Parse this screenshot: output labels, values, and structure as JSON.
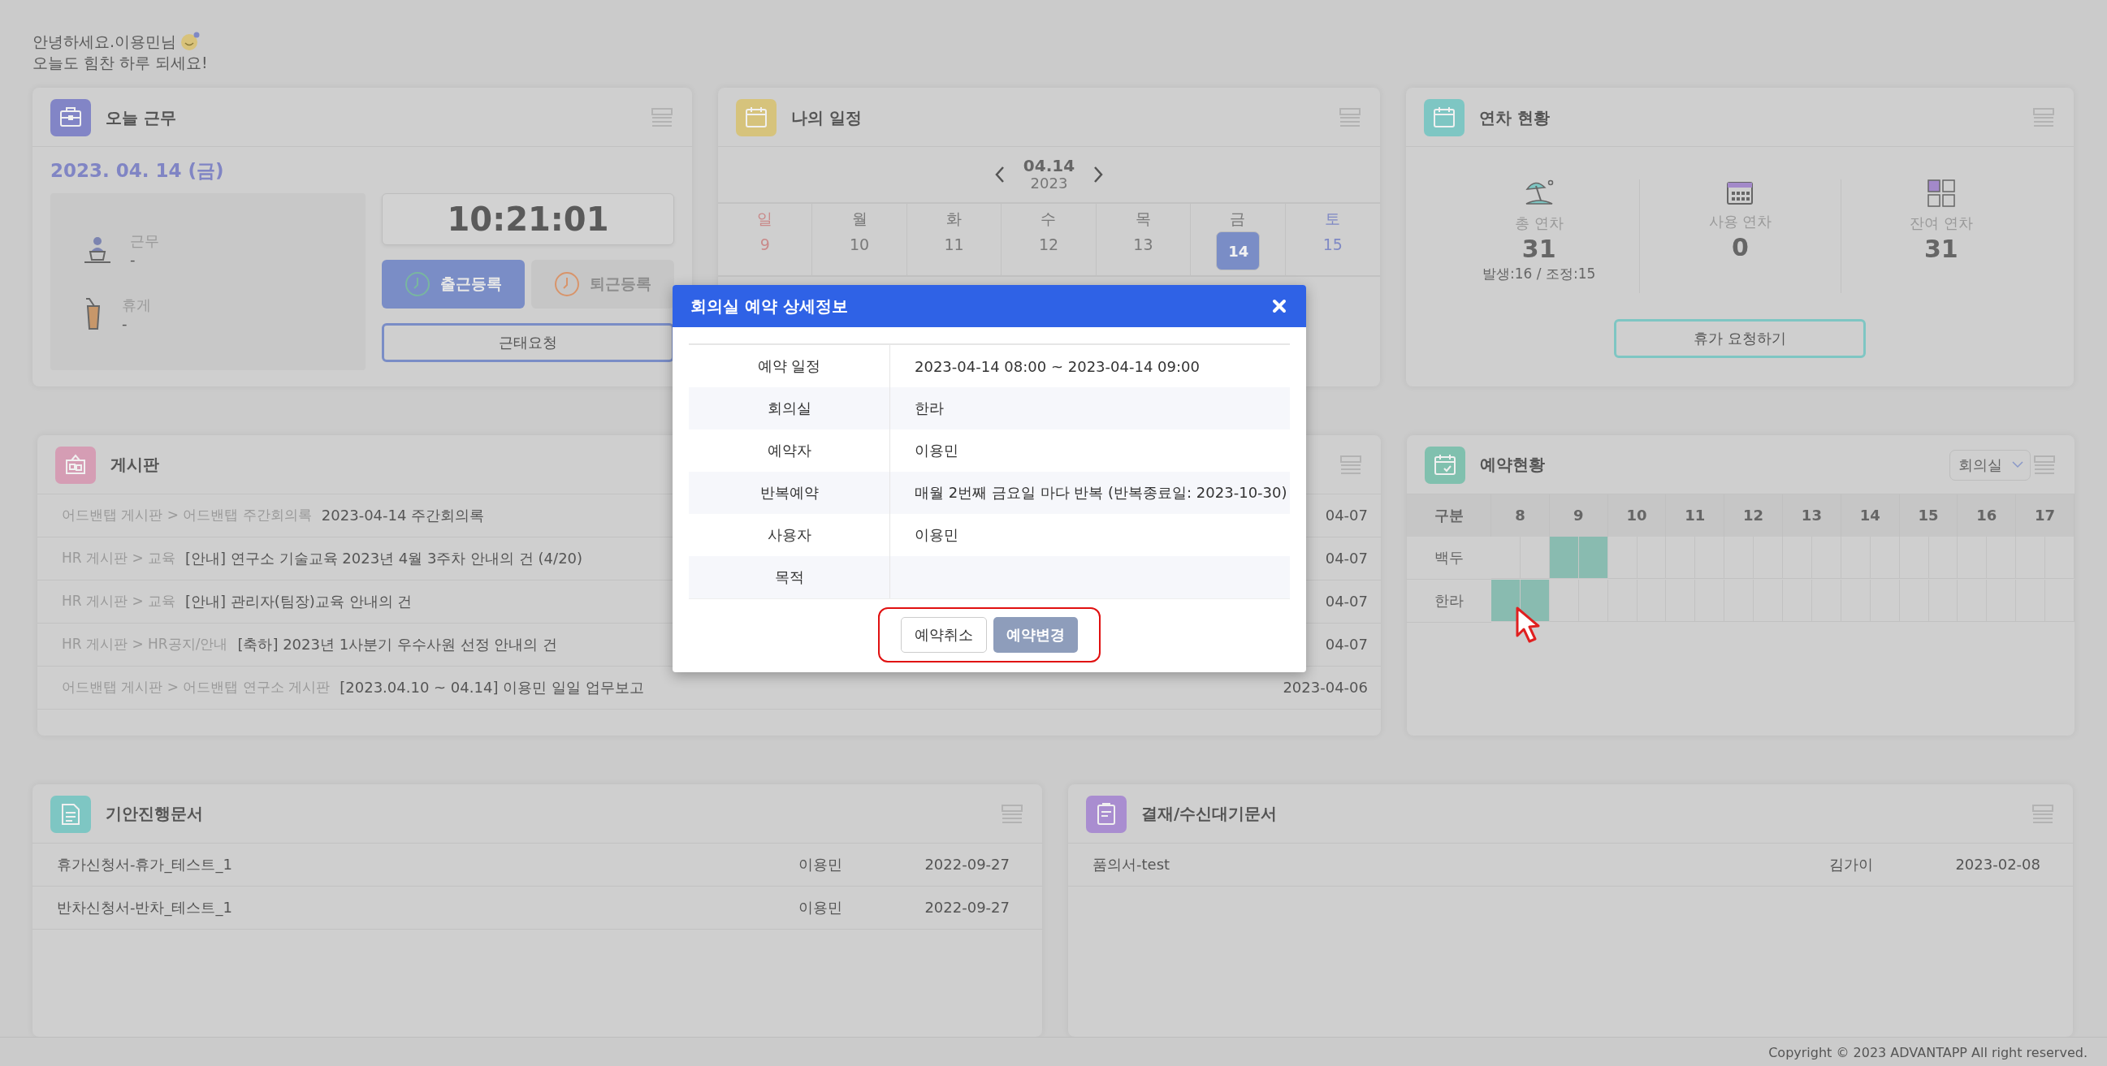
{
  "greeting": {
    "line1": "안녕하세요.이용민님",
    "line2": "오늘도 힘찬 하루 되세요!"
  },
  "today_work": {
    "title": "오늘 근무",
    "date": "2023. 04. 14 (금)",
    "clock": "10:21:01",
    "request_button": "근태요청",
    "status": [
      {
        "kind": "work",
        "label": "근무",
        "value": "-"
      },
      {
        "kind": "break",
        "label": "휴게",
        "value": "-"
      }
    ],
    "buttons": [
      {
        "kind": "clock_in",
        "label": "출근등록",
        "disabled": false
      },
      {
        "kind": "clock_out",
        "label": "퇴근등록",
        "disabled": true
      }
    ]
  },
  "schedule": {
    "title": "나의 일정",
    "date": "04.14",
    "year": "2023",
    "days": [
      {
        "kind": "sunday",
        "weekday": "일",
        "day": "9",
        "selected": false
      },
      {
        "kind": "weekday",
        "weekday": "월",
        "day": "10",
        "selected": false
      },
      {
        "kind": "weekday",
        "weekday": "화",
        "day": "11",
        "selected": false
      },
      {
        "kind": "weekday",
        "weekday": "수",
        "day": "12",
        "selected": false
      },
      {
        "kind": "weekday",
        "weekday": "목",
        "day": "13",
        "selected": false
      },
      {
        "kind": "weekday",
        "weekday": "금",
        "day": "14",
        "selected": true
      },
      {
        "kind": "saturday",
        "weekday": "토",
        "day": "15",
        "selected": false
      }
    ]
  },
  "leave": {
    "title": "연차 현황",
    "button": "휴가 요청하기",
    "stats": [
      {
        "kind": "total",
        "label": "총 연차",
        "value": "31",
        "note": "발생:16 / 조정:15"
      },
      {
        "kind": "used",
        "label": "사용 연차",
        "value": "0"
      },
      {
        "kind": "remaining",
        "label": "잔여 연차",
        "value": "31"
      }
    ]
  },
  "board": {
    "title": "게시판",
    "posts": [
      {
        "path": "어드밴탭 게시판 > 어드밴탭 주간회의록",
        "title": "2023-04-14 주간회의록",
        "date": "04-07"
      },
      {
        "path": "HR 게시판 > 교육",
        "title": "[안내] 연구소 기술교육 2023년 4월 3주차 안내의 건 (4/20)",
        "date": "04-07"
      },
      {
        "path": "HR 게시판 > 교육",
        "title": "[안내] 관리자(팀장)교육 안내의 건",
        "date": "04-07"
      },
      {
        "path": "HR 게시판 > HR공지/안내",
        "title": "[축하] 2023년 1사분기 우수사원 선정 안내의 건",
        "date": "04-07"
      },
      {
        "path": "어드밴탭 게시판 > 어드밴탭 연구소 게시판",
        "title": "[2023.04.10 ~ 04.14] 이용민 일일 업무보고",
        "date": "2023-04-06"
      }
    ]
  },
  "reservations": {
    "title": "예약현황",
    "select": "회의실",
    "columns": [
      "구분",
      "8",
      "9",
      "10",
      "11",
      "12",
      "13",
      "14",
      "15",
      "16",
      "17"
    ],
    "rows": [
      {
        "name": "백두",
        "booked": [
          false,
          false,
          true,
          true,
          false,
          false,
          false,
          false,
          false,
          false,
          false,
          false,
          false,
          false,
          false,
          false,
          false,
          false,
          false,
          false
        ]
      },
      {
        "name": "한라",
        "booked": [
          true,
          true,
          false,
          false,
          false,
          false,
          false,
          false,
          false,
          false,
          false,
          false,
          false,
          false,
          false,
          false,
          false,
          false,
          false,
          false
        ]
      }
    ]
  },
  "drafts": {
    "title": "기안진행문서",
    "rows": [
      {
        "title": "휴가신청서-휴가_테스트_1",
        "author": "이용민",
        "date": "2022-09-27"
      },
      {
        "title": "반차신청서-반차_테스트_1",
        "author": "이용민",
        "date": "2022-09-27"
      }
    ]
  },
  "approvals": {
    "title": "결재/수신대기문서",
    "rows": [
      {
        "title": "품의서-test",
        "author": "김가이",
        "date": "2023-02-08"
      }
    ]
  },
  "footer": "Copyright © 2023 ADVANTAPP All right reserved.",
  "modal": {
    "title": "회의실 예약 상세정보",
    "highlighted": true,
    "fields": [
      {
        "label": "예약 일정",
        "value": "2023-04-14 08:00 ~ 2023-04-14 09:00"
      },
      {
        "label": "회의실",
        "value": "한라"
      },
      {
        "label": "예약자",
        "value": "이용민"
      },
      {
        "label": "반복예약",
        "value": "매월 2번째 금요일 마다 반복 (반복종료일: 2023-10-30)"
      },
      {
        "label": "사용자",
        "value": "이용민"
      },
      {
        "label": "목적"
      }
    ],
    "buttons": [
      {
        "kind": "secondary",
        "label": "예약취소"
      },
      {
        "kind": "primary",
        "label": "예약변경"
      }
    ]
  }
}
